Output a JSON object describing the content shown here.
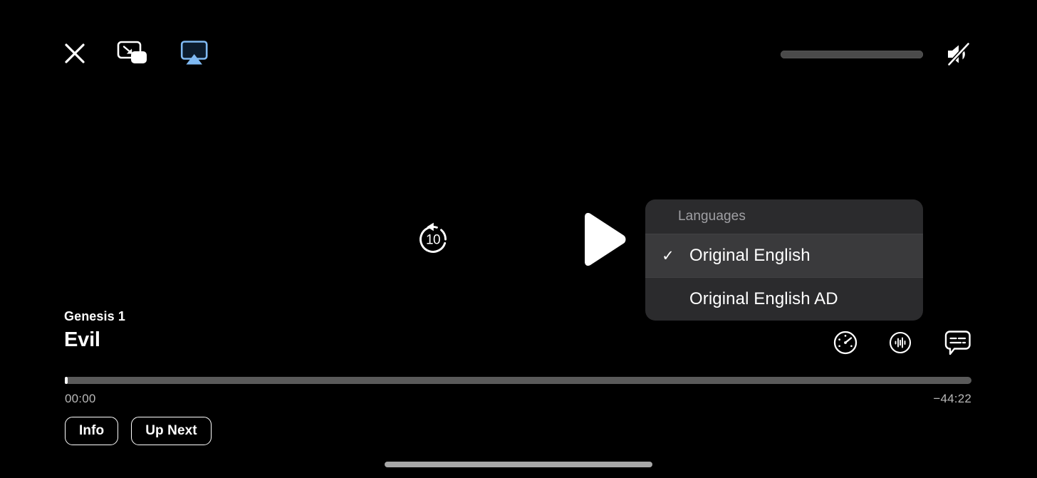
{
  "top_bar": {
    "close_icon": "close-icon",
    "pip_icon": "picture-in-picture-icon",
    "airplay_icon": "airplay-icon",
    "airplay_color": "#7FB9F2",
    "volume": {
      "icon": "volume-muted-icon",
      "level_percent": 0,
      "muted": true
    }
  },
  "transport": {
    "skip_back_label": "10",
    "skip_back_icon": "skip-back-10-icon",
    "play_icon": "play-icon",
    "state": "paused"
  },
  "languages_menu": {
    "header": "Languages",
    "options": [
      {
        "label": "Original English",
        "selected": true,
        "check": "✓"
      },
      {
        "label": "Original English AD",
        "selected": false,
        "check": "✓"
      }
    ]
  },
  "now_playing": {
    "subtitle": "Genesis 1",
    "title": "Evil"
  },
  "bottom_icons": [
    {
      "name": "playback-speed-icon"
    },
    {
      "name": "audio-track-icon"
    },
    {
      "name": "subtitles-icon"
    }
  ],
  "progress": {
    "elapsed": "00:00",
    "remaining": "−44:22",
    "percent": 0.3
  },
  "pills": [
    {
      "label": "Info"
    },
    {
      "label": "Up Next"
    }
  ],
  "colors": {
    "background": "#000000",
    "menu_background": "#2b2b2d",
    "menu_selected": "#3a3a3c",
    "track": "#5a5a5a",
    "accent_blue": "#7FB9F2",
    "text_primary": "#ffffff",
    "text_secondary": "#a0a0a4"
  }
}
